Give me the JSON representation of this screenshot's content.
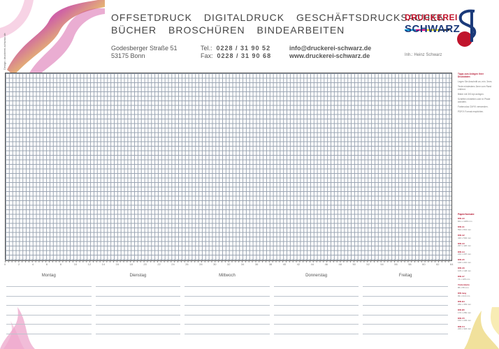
{
  "side_credit": "Design: druckerei-schwarz.de",
  "services": {
    "line1": [
      "OFFSETDRUCK",
      "DIGITALDRUCK",
      "GESCHÄFTSDRUCKSACHEN"
    ],
    "line2": [
      "BÜCHER",
      "BROSCHÜREN",
      "BINDEARBEITEN"
    ]
  },
  "address": {
    "street": "Godesberger Straße 51",
    "city": "53175 Bonn"
  },
  "contact": {
    "tel_label": "Tel.:",
    "tel": "0228 / 31 90 52",
    "fax_label": "Fax:",
    "fax": "0228 / 31 90 68",
    "email": "info@druckerei-schwarz.de",
    "web": "www.druckerei-schwarz.de"
  },
  "owner": "Inh.: Heinz Schwarz",
  "logo": {
    "line1": "DRUCKEREI",
    "line2": "SCHWARZ"
  },
  "ruler_labels": [
    "0",
    "2",
    "4",
    "6",
    "8",
    "10",
    "12",
    "14",
    "16",
    "18",
    "20",
    "22",
    "24",
    "26",
    "28",
    "30",
    "32",
    "34",
    "36",
    "38",
    "40",
    "42",
    "44",
    "46",
    "48",
    "50",
    "52",
    "54",
    "56",
    "58",
    "60",
    "62",
    "64"
  ],
  "days": [
    "Montag",
    "Dienstag",
    "Mittwoch",
    "Donnerstag",
    "Freitag"
  ],
  "right_column": {
    "heading": "Tipps zum Anlegen Ihrer Druckdaten",
    "tips": [
      "Legen Sie Anschnitt an, min. 3mm.",
      "Texte mindestens 3mm vom Rand entfernt.",
      "Bilder mit 300 dpi anlegen.",
      "Schriften einbetten oder in Pfade wandeln.",
      "Farbmodus CMYK verwenden.",
      "PDF/X Format empfohlen."
    ]
  },
  "paper": {
    "heading": "Papierformate",
    "items": [
      {
        "name": "DIN A0",
        "size": "841 x 1189 mm"
      },
      {
        "name": "DIN A1",
        "size": "594 x 841 mm"
      },
      {
        "name": "DIN A2",
        "size": "420 x 594 mm"
      },
      {
        "name": "DIN A3",
        "size": "297 x 420 mm"
      },
      {
        "name": "DIN A4",
        "size": "210 x 297 mm"
      },
      {
        "name": "DIN A5",
        "size": "148 x 210 mm"
      },
      {
        "name": "DIN A6",
        "size": "105 x 148 mm"
      },
      {
        "name": "DIN A7",
        "size": "74 x 105 mm"
      },
      {
        "name": "Visitenkarte",
        "size": "85 x 55 mm"
      },
      {
        "name": "DIN lang",
        "size": "99 x 210 mm"
      },
      {
        "name": "DIN B4",
        "size": "250 x 353 mm"
      },
      {
        "name": "DIN B5",
        "size": "176 x 250 mm"
      },
      {
        "name": "DIN C5",
        "size": "162 x 229 mm"
      },
      {
        "name": "DIN C4",
        "size": "229 x 324 mm"
      }
    ]
  },
  "colors": {
    "brand_red": "#c0142c",
    "brand_blue": "#1b3a7a",
    "grid": "#9aa4b2"
  }
}
